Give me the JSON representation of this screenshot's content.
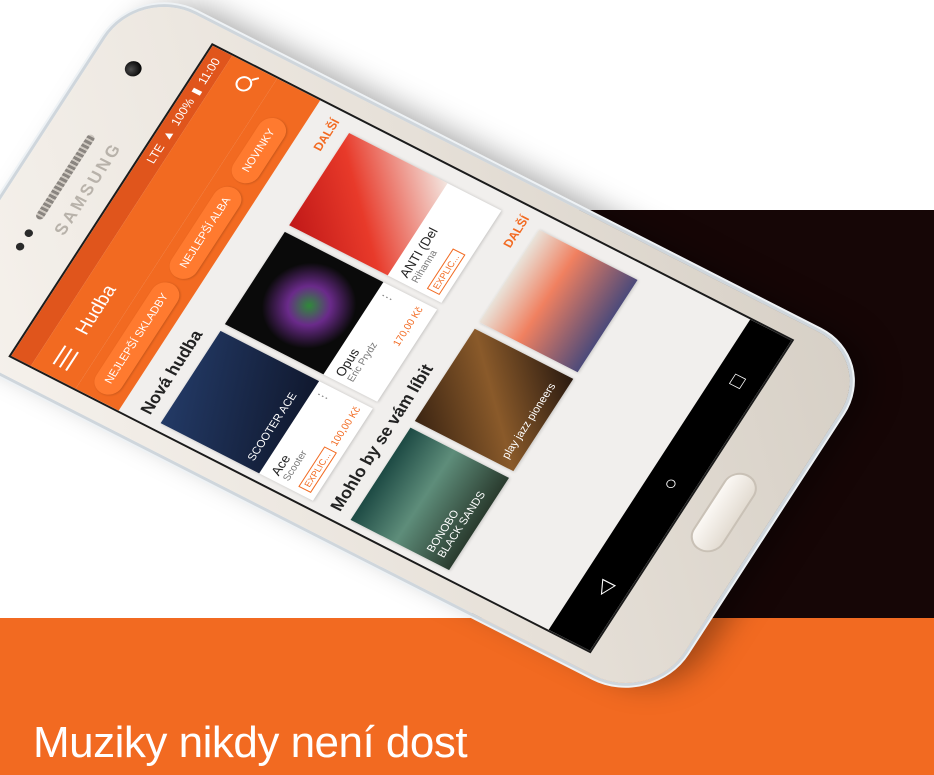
{
  "banner": {
    "text": "Muziky nikdy není dost"
  },
  "phone": {
    "brand": "SAMSUNG"
  },
  "status_bar": {
    "network": "LTE",
    "battery": "100%",
    "time": "11:00"
  },
  "app_bar": {
    "title": "Hudba"
  },
  "chips": [
    "NEJLEPŠÍ SKLADBY",
    "NEJLEPŠÍ ALBA",
    "NOVINKY"
  ],
  "section_new": {
    "title": "Nová hudba",
    "more": "DALŠÍ",
    "items": [
      {
        "title": "Ace",
        "artist": "Scooter",
        "badge": "EXPLIC...",
        "price": "100,00 Kč",
        "cover_text": "SCOOTER ACE"
      },
      {
        "title": "Opus",
        "artist": "Eric Prydz",
        "badge": "",
        "price": "170,00 Kč",
        "cover_text": ""
      },
      {
        "title": "ANTI (Del",
        "artist": "Rihanna",
        "badge": "EXPLIC...",
        "price": "",
        "cover_text": ""
      }
    ]
  },
  "section_recommend": {
    "title": "Mohlo by se vám líbit",
    "more": "DALŠÍ",
    "items": [
      {
        "cover_text": "BONOBO\nBLACK SANDS"
      },
      {
        "cover_text": "play jazz pioneers"
      },
      {
        "cover_text": ""
      }
    ]
  },
  "nav": {
    "back": "◁",
    "home": "○",
    "recents": "□"
  },
  "colors": {
    "accent": "#f26a21",
    "dark": "#160606"
  }
}
